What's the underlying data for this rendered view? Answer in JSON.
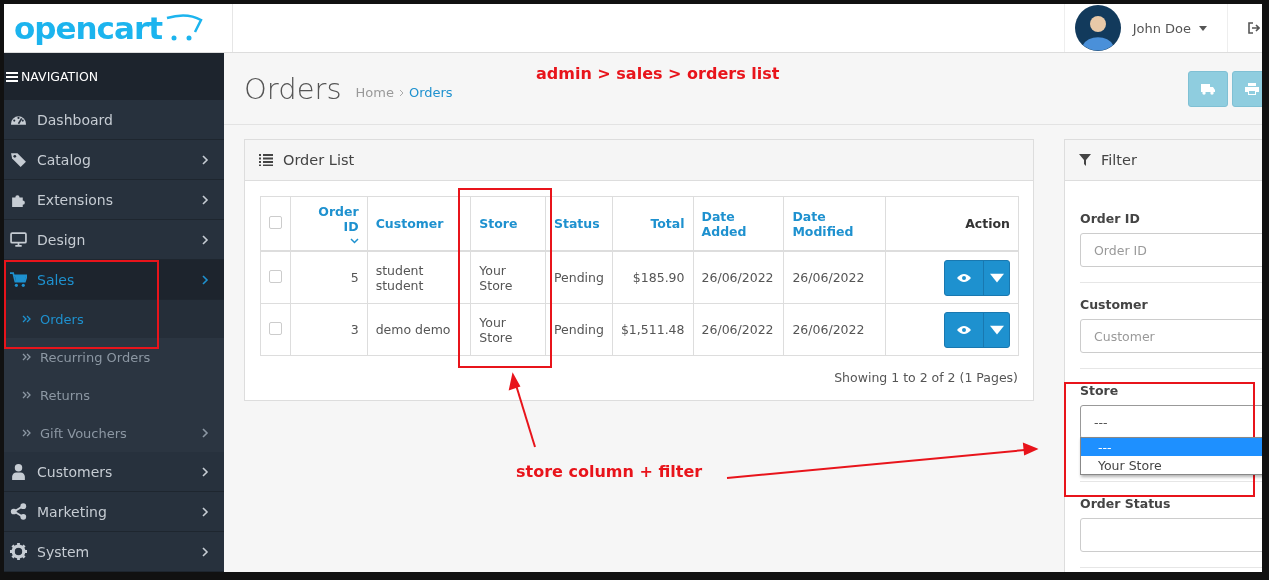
{
  "header": {
    "logo": "opencart",
    "user": "John Doe"
  },
  "sidebar": {
    "title": "NAVIGATION",
    "items": [
      {
        "label": "Dashboard",
        "expandable": false,
        "expanded": false,
        "selected": false
      },
      {
        "label": "Catalog",
        "expandable": true,
        "expanded": false,
        "selected": false
      },
      {
        "label": "Extensions",
        "expandable": true,
        "expanded": false,
        "selected": false
      },
      {
        "label": "Design",
        "expandable": true,
        "expanded": false,
        "selected": false
      },
      {
        "label": "Sales",
        "expandable": true,
        "expanded": true,
        "selected": true,
        "children": [
          {
            "label": "Orders",
            "expandable": false,
            "selected": true
          },
          {
            "label": "Recurring Orders",
            "expandable": false,
            "selected": false
          },
          {
            "label": "Returns",
            "expandable": false,
            "selected": false
          },
          {
            "label": "Gift Vouchers",
            "expandable": true,
            "selected": false
          }
        ]
      },
      {
        "label": "Customers",
        "expandable": true,
        "expanded": false,
        "selected": false
      },
      {
        "label": "Marketing",
        "expandable": true,
        "expanded": false,
        "selected": false
      },
      {
        "label": "System",
        "expandable": true,
        "expanded": false,
        "selected": false
      }
    ]
  },
  "page": {
    "title": "Orders",
    "breadcrumb": [
      {
        "label": "Home",
        "current": false
      },
      {
        "label": "Orders",
        "current": true
      }
    ]
  },
  "order_list": {
    "title": "Order List",
    "select_all": {
      "checked": false
    },
    "columns": [
      {
        "label": "Order ID",
        "kind": "number",
        "link": true,
        "sorted": true
      },
      {
        "label": "Customer",
        "kind": "text",
        "link": true,
        "sorted": false
      },
      {
        "label": "Store",
        "kind": "text",
        "link": true,
        "sorted": false
      },
      {
        "label": "Status",
        "kind": "text",
        "link": true,
        "sorted": false
      },
      {
        "label": "Total",
        "kind": "number",
        "link": true,
        "sorted": false
      },
      {
        "label": "Date Added",
        "kind": "text",
        "link": true,
        "sorted": false
      },
      {
        "label": "Date Modified",
        "kind": "text",
        "link": true,
        "sorted": false
      },
      {
        "label": "Action",
        "kind": "action",
        "link": false,
        "sorted": false
      }
    ],
    "rows": [
      {
        "checked": false,
        "cells": [
          "5",
          "student student",
          "Your Store",
          "Pending",
          "$185.90",
          "26/06/2022",
          "26/06/2022"
        ]
      },
      {
        "checked": false,
        "cells": [
          "3",
          "demo demo",
          "Your Store",
          "Pending",
          "$1,511.48",
          "26/06/2022",
          "26/06/2022"
        ]
      }
    ],
    "summary": "Showing 1 to 2 of 2 (1 Pages)"
  },
  "filter": {
    "title": "Filter",
    "fields": [
      {
        "label": "Order ID",
        "kind": "input",
        "placeholder": "Order ID"
      },
      {
        "label": "Customer",
        "kind": "input",
        "placeholder": "Customer"
      },
      {
        "label": "Store",
        "kind": "select",
        "value": "---",
        "open": true,
        "options": [
          {
            "label": "---",
            "selected": true
          },
          {
            "label": "Your Store",
            "selected": false
          }
        ]
      },
      {
        "label": "Order Status",
        "kind": "select",
        "open": false
      }
    ]
  },
  "annotations": [
    {
      "text": "admin > sales > orders list"
    },
    {
      "text": "store column + filter"
    }
  ]
}
